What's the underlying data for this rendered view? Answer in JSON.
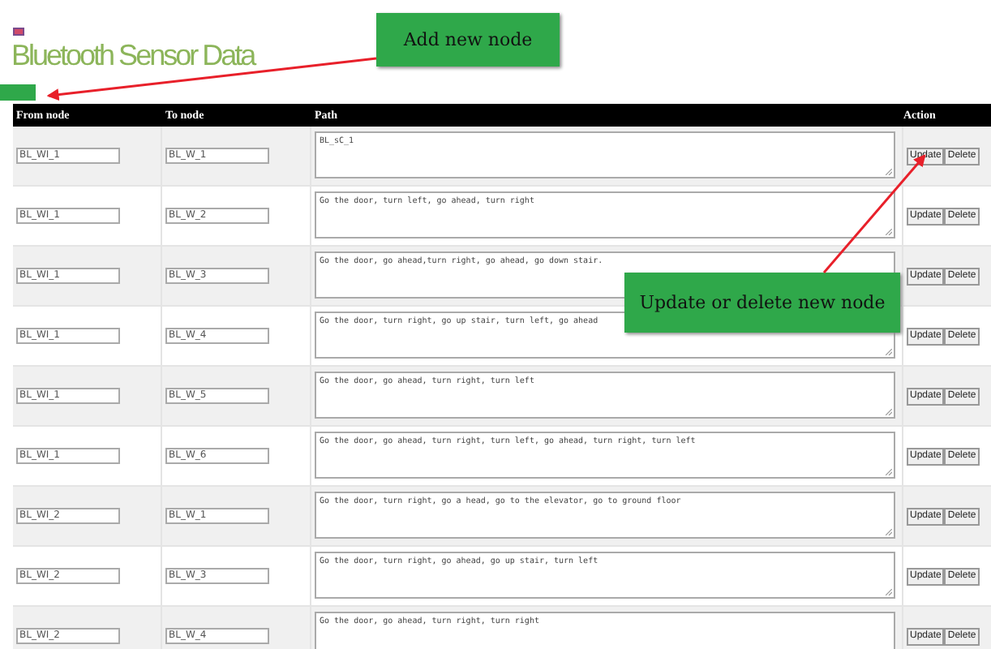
{
  "title": "Bluetooth Sensor Data",
  "columns": [
    "From node",
    "To node",
    "Path",
    "Action"
  ],
  "rows": [
    {
      "from": "BL_WI_1",
      "to": "BL_W_1",
      "path": "BL_sC_1",
      "update": "Update",
      "delete": "Delete"
    },
    {
      "from": "BL_WI_1",
      "to": "BL_W_2",
      "path": "Go the door, turn left, go ahead, turn right",
      "update": "Update",
      "delete": "Delete"
    },
    {
      "from": "BL_WI_1",
      "to": "BL_W_3",
      "path": "Go the door, go ahead,turn right, go ahead, go down stair.",
      "update": "Update",
      "delete": "Delete"
    },
    {
      "from": "BL_WI_1",
      "to": "BL_W_4",
      "path": "Go the door, turn right, go up stair, turn left, go ahead",
      "update": "Update",
      "delete": "Delete"
    },
    {
      "from": "BL_WI_1",
      "to": "BL_W_5",
      "path": "Go the door, go ahead, turn right, turn left",
      "update": "Update",
      "delete": "Delete"
    },
    {
      "from": "BL_WI_1",
      "to": "BL_W_6",
      "path": "Go the door, go ahead, turn right, turn left, go ahead, turn right, turn left",
      "update": "Update",
      "delete": "Delete"
    },
    {
      "from": "BL_WI_2",
      "to": "BL_W_1",
      "path": "Go the door, turn right, go a head, go to the elevator, go to ground floor",
      "update": "Update",
      "delete": "Delete"
    },
    {
      "from": "BL_WI_2",
      "to": "BL_W_3",
      "path": "Go the door, turn right, go ahead, go up stair, turn left",
      "update": "Update",
      "delete": "Delete"
    },
    {
      "from": "BL_WI_2",
      "to": "BL_W_4",
      "path": "Go the door, go ahead, turn right, turn right",
      "update": "Update",
      "delete": "Delete"
    }
  ],
  "callouts": [
    {
      "text": "Add new node"
    },
    {
      "text": "Update or delete new node"
    }
  ]
}
